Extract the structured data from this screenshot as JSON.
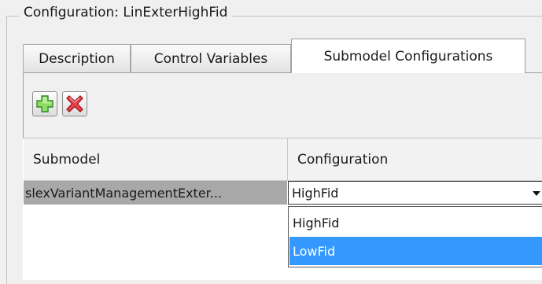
{
  "group": {
    "title": "Configuration: LinExterHighFid"
  },
  "tabs": [
    {
      "label": "Description",
      "active": false
    },
    {
      "label": "Control Variables",
      "active": false
    },
    {
      "label": "Submodel Configurations",
      "active": true
    }
  ],
  "toolbar": {
    "add_icon": "add-icon",
    "delete_icon": "delete-icon"
  },
  "table": {
    "columns": [
      "Submodel",
      "Configuration"
    ],
    "rows": [
      {
        "submodel": "slexVariantManagementExter...",
        "configuration": "HighFid"
      }
    ]
  },
  "dropdown": {
    "options": [
      "HighFid",
      "LowFid"
    ],
    "highlighted": "LowFid"
  },
  "colors": {
    "selection": "#3399ff",
    "row_selected": "#a8a8a8",
    "add_green": "#3cb43c",
    "delete_red": "#d0202a"
  }
}
